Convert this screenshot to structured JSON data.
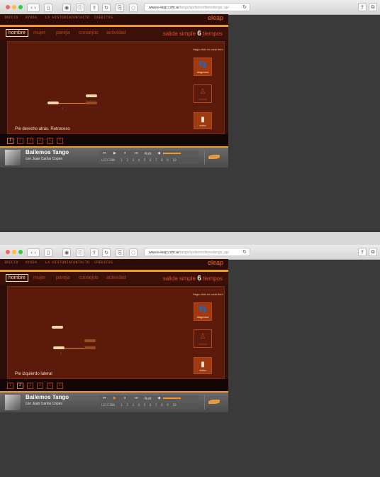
{
  "browser": {
    "url_host": "www.e-leap.com.ar",
    "url_path": "/tango/sp/demo/demotango_sp/",
    "toolbar_icons": [
      "back-icon",
      "forward-icon",
      "sidebar-icon",
      "shield-icon",
      "info-icon",
      "share-icon",
      "reader-icon",
      "reload-icon",
      "ghost-icon"
    ]
  },
  "screens": [
    {
      "nav": [
        "INICIO",
        "AYUDA",
        "LA HISTORIA",
        "CONTACTO",
        "CRÉDITOS"
      ],
      "logo": "eleap",
      "tabs": [
        "hombre",
        "mujer",
        "pareja",
        "consejos",
        "actividad"
      ],
      "active_tab": "hombre",
      "title_prefix": "salida simple",
      "title_number": "6",
      "title_suffix": "tiempos",
      "hint": "Haga click en cada ítem",
      "buttons": [
        "diagrama",
        "silueta",
        "video"
      ],
      "caption": "Pie derecho atrás. Retroceso",
      "foot_label": "1",
      "lessons": [
        "1",
        "2",
        "3",
        "4",
        "5",
        "6"
      ],
      "current_lesson": 0,
      "player_title": "Bailemos Tango",
      "player_subtitle": "con Juan Carlos Copes",
      "player_controls": [
        "⏮",
        "▶",
        "⏸",
        "⏭",
        "PLAY"
      ],
      "lesson_row": "LECCIÓN   1  2  3  4  5  6  7  8  9  10"
    },
    {
      "nav": [
        "INICIO",
        "AYUDA",
        "LA HISTORIA",
        "CONTACTO",
        "CRÉDITOS"
      ],
      "logo": "eleap",
      "tabs": [
        "hombre",
        "mujer",
        "pareja",
        "consejos",
        "actividad"
      ],
      "active_tab": "hombre",
      "title_prefix": "salida simple",
      "title_number": "6",
      "title_suffix": "tiempos",
      "hint": "Haga click en cada ítem",
      "buttons": [
        "diagrama",
        "silueta",
        "video"
      ],
      "caption": "Pie izquierdo lateral",
      "foot_label": "2",
      "lessons": [
        "1",
        "2",
        "3",
        "4",
        "5",
        "6"
      ],
      "current_lesson": 1,
      "player_title": "Bailemos Tango",
      "player_subtitle": "con Juan Carlos Copes",
      "player_controls": [
        "⏮",
        "▶",
        "⏸",
        "⏭",
        "PLAY"
      ],
      "lesson_row": "LECCIÓN   1  2  3  4  5  6  7  8  9  10"
    }
  ]
}
